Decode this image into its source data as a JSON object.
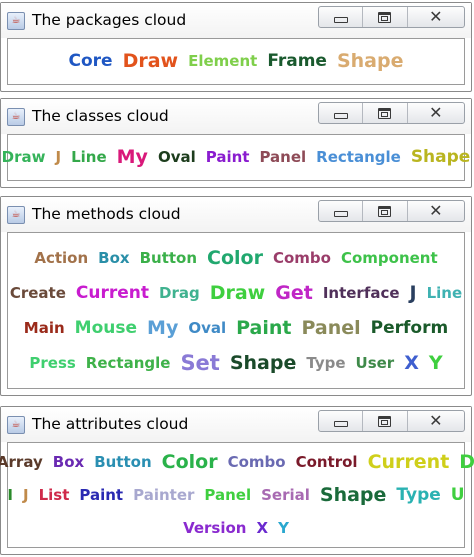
{
  "windows": [
    {
      "title": "The packages cloud",
      "rows": [
        [
          {
            "text": "Core",
            "color": "#1f57c3",
            "size": 2
          },
          {
            "text": "Draw",
            "color": "#e2531c",
            "size": 3
          },
          {
            "text": "Element",
            "color": "#7fcf4b",
            "size": 1
          },
          {
            "text": "Frame",
            "color": "#1a5a2e",
            "size": 2
          },
          {
            "text": "Shape",
            "color": "#d9ab70",
            "size": 3
          }
        ]
      ]
    },
    {
      "title": "The classes cloud",
      "rows": [
        [
          {
            "text": "Draw",
            "color": "#35b35a",
            "size": 1
          },
          {
            "text": "J",
            "color": "#c08a4a",
            "size": 1
          },
          {
            "text": "Line",
            "color": "#34a84a",
            "size": 1
          },
          {
            "text": "My",
            "color": "#d9197a",
            "size": 3
          },
          {
            "text": "Oval",
            "color": "#1d3d1d",
            "size": 1
          },
          {
            "text": "Paint",
            "color": "#8a1ccf",
            "size": 1
          },
          {
            "text": "Panel",
            "color": "#8e4b57",
            "size": 1
          },
          {
            "text": "Rectangle",
            "color": "#4a8fd6",
            "size": 1
          },
          {
            "text": "Shape",
            "color": "#b9b520",
            "size": 2
          }
        ]
      ]
    },
    {
      "title": "The methods cloud",
      "rows": [
        [
          {
            "text": "Action",
            "color": "#a2724a",
            "size": 1
          },
          {
            "text": "Box",
            "color": "#2a8fa8",
            "size": 1
          },
          {
            "text": "Button",
            "color": "#3bb04a",
            "size": 1
          },
          {
            "text": "Color",
            "color": "#21a86f",
            "size": 3
          },
          {
            "text": "Combo",
            "color": "#9a3d6a",
            "size": 1
          },
          {
            "text": "Component",
            "color": "#3ec24a",
            "size": 1
          }
        ],
        [
          {
            "text": "Create",
            "color": "#6a4a3a",
            "size": 1
          },
          {
            "text": "Current",
            "color": "#c81ccf",
            "size": 2
          },
          {
            "text": "Drag",
            "color": "#3fb28f",
            "size": 1
          },
          {
            "text": "Draw",
            "color": "#3fcf3f",
            "size": 3
          },
          {
            "text": "Get",
            "color": "#c026c6",
            "size": 3
          },
          {
            "text": "Interface",
            "color": "#50305a",
            "size": 1
          },
          {
            "text": "J",
            "color": "#2a3f5f",
            "size": 3
          },
          {
            "text": "Line",
            "color": "#3fb2b2",
            "size": 1
          }
        ],
        [
          {
            "text": "Main",
            "color": "#9a2a1a",
            "size": 1
          },
          {
            "text": "Mouse",
            "color": "#3fcf6f",
            "size": 2
          },
          {
            "text": "My",
            "color": "#5a9fd6",
            "size": 3
          },
          {
            "text": "Oval",
            "color": "#3f8ac6",
            "size": 1
          },
          {
            "text": "Paint",
            "color": "#2aa84a",
            "size": 3
          },
          {
            "text": "Panel",
            "color": "#8a8a5a",
            "size": 3
          },
          {
            "text": "Perform",
            "color": "#1a5a2a",
            "size": 2
          }
        ],
        [
          {
            "text": "Press",
            "color": "#3fcf6f",
            "size": 1
          },
          {
            "text": "Rectangle",
            "color": "#3fb24a",
            "size": 1
          },
          {
            "text": "Set",
            "color": "#8a7ad6",
            "size": 4
          },
          {
            "text": "Shape",
            "color": "#1a4a2a",
            "size": 3
          },
          {
            "text": "Type",
            "color": "#8a8a8a",
            "size": 1
          },
          {
            "text": "User",
            "color": "#3f8a4a",
            "size": 1
          },
          {
            "text": "X",
            "color": "#3f5fcf",
            "size": 3
          },
          {
            "text": "Y",
            "color": "#3fcf3f",
            "size": 3
          }
        ]
      ]
    },
    {
      "title": "The attributes cloud",
      "rows": [
        [
          {
            "text": "Array",
            "color": "#5a3a2a",
            "size": 1
          },
          {
            "text": "Box",
            "color": "#6a2ab2",
            "size": 1
          },
          {
            "text": "Button",
            "color": "#2a8fb2",
            "size": 1
          },
          {
            "text": "Color",
            "color": "#2ab24a",
            "size": 3
          },
          {
            "text": "Combo",
            "color": "#6a6ab2",
            "size": 1
          },
          {
            "text": "Control",
            "color": "#7a1a2a",
            "size": 1
          },
          {
            "text": "Current",
            "color": "#cfcf1a",
            "size": 3
          },
          {
            "text": "D",
            "color": "#3fcf3f",
            "size": 3
          }
        ],
        [
          {
            "text": "I",
            "color": "#2a8a2a",
            "size": 1
          },
          {
            "text": "J",
            "color": "#c08a4a",
            "size": 1
          },
          {
            "text": "List",
            "color": "#cf2a4a",
            "size": 1
          },
          {
            "text": "Paint",
            "color": "#2a2ab2",
            "size": 1
          },
          {
            "text": "Painter",
            "color": "#a8a8cf",
            "size": 1
          },
          {
            "text": "Panel",
            "color": "#3fcf3f",
            "size": 1
          },
          {
            "text": "Serial",
            "color": "#a86ab2",
            "size": 1
          },
          {
            "text": "Shape",
            "color": "#1a6a3a",
            "size": 3
          },
          {
            "text": "Type",
            "color": "#2ab2b2",
            "size": 2
          },
          {
            "text": "U",
            "color": "#3fcf3f",
            "size": 2
          }
        ],
        [
          {
            "text": "Version",
            "color": "#8a2acf",
            "size": 1
          },
          {
            "text": "X",
            "color": "#6a2acf",
            "size": 1
          },
          {
            "text": "Y",
            "color": "#2aa8cf",
            "size": 1
          }
        ]
      ]
    }
  ]
}
